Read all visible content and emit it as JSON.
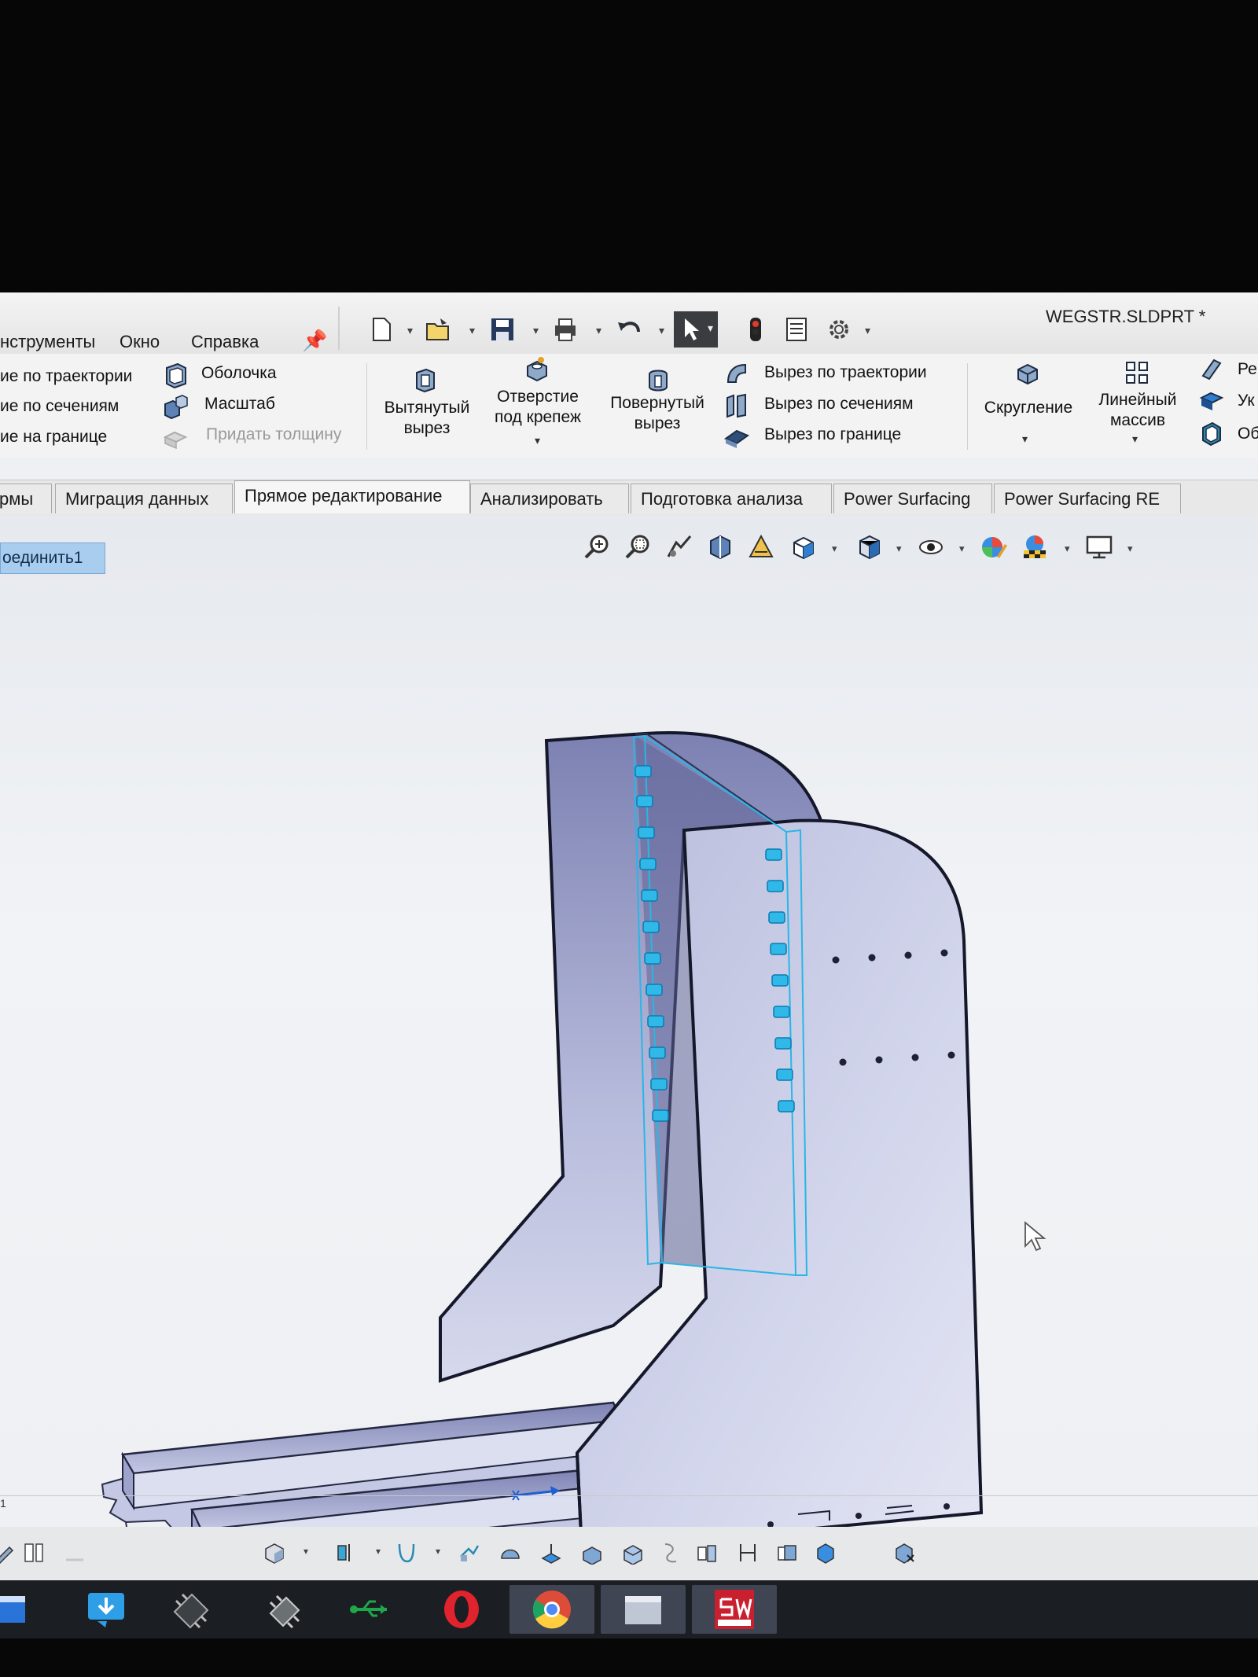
{
  "window": {
    "doc_title": "WEGSTR.SLDPRT *"
  },
  "menu": {
    "items": [
      "нструменты",
      "Окно",
      "Справка"
    ]
  },
  "ribbon": {
    "left_col": [
      "ие по траектории",
      "ие по сечениям",
      "ие на границе"
    ],
    "shell": "Оболочка",
    "scale": "Масштаб",
    "thicken": "Придать толщину",
    "extruded_cut": [
      "Вытянутый",
      "вырез"
    ],
    "hole": [
      "Отверстие",
      "под крепеж"
    ],
    "revolved_cut": [
      "Повернутый",
      "вырез"
    ],
    "sweep_cut": "Вырез по траектории",
    "loft_cut": "Вырез по сечениям",
    "boundary_cut": "Вырез по границе",
    "fillet": "Скругление",
    "linear_pattern": [
      "Линейный",
      "массив"
    ],
    "right_partial": [
      "Ре",
      "Ук",
      "Об"
    ]
  },
  "tabs": [
    "рмы",
    "Миграция данных",
    "Прямое редактирование",
    "Анализировать",
    "Подготовка анализа",
    "Power Surfacing",
    "Power Surfacing RE"
  ],
  "viewport": {
    "feature_tag": "оединить1"
  },
  "status": {
    "line_number": "1"
  },
  "colors": {
    "selection_highlight": "#29b6e6",
    "part_face": "#c5c9e3",
    "part_face_dark": "#7d82b0",
    "feature_tag_bg": "#a9cdee"
  },
  "taskbar": {
    "apps": [
      "explorer-icon",
      "download-icon",
      "chip-app-icon",
      "chip2-app-icon",
      "usb-icon",
      "opera-icon",
      "chrome-icon",
      "file-manager-icon",
      "solidworks-2017-icon"
    ]
  }
}
